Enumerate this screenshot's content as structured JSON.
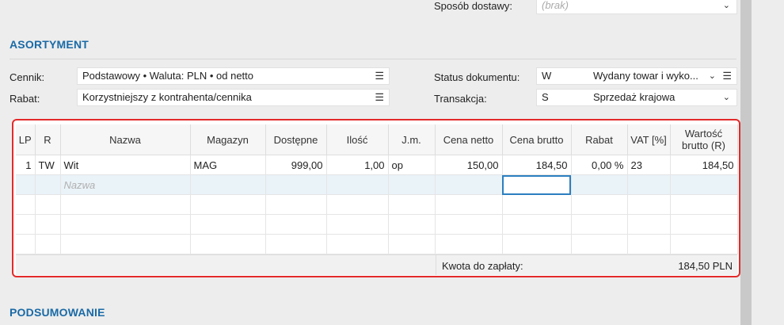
{
  "header": {
    "sposob_label": "Sposób dostawy:",
    "sposob_value": "(brak)"
  },
  "asortyment": {
    "title": "ASORTYMENT",
    "cennik_label": "Cennik:",
    "cennik_value": "Podstawowy • Waluta: PLN • od netto",
    "rabat_label": "Rabat:",
    "rabat_value": "Korzystniejszy z kontrahenta/cennika",
    "status_label": "Status dokumentu:",
    "status_code": "W",
    "status_value": "Wydany towar i wyko...",
    "transakcja_label": "Transakcja:",
    "transakcja_code": "S",
    "transakcja_value": "Sprzedaż krajowa"
  },
  "grid": {
    "columns": [
      "LP",
      "R",
      "Nazwa",
      "Magazyn",
      "Dostępne",
      "Ilość",
      "J.m.",
      "Cena netto",
      "Cena brutto",
      "Rabat",
      "VAT [%]",
      "Wartość brutto (R)"
    ],
    "row1": {
      "lp": "1",
      "r": "TW",
      "nazwa": "Wit",
      "magazyn": "MAG",
      "dostepne": "999,00",
      "ilosc": "1,00",
      "jm": "op",
      "cena_netto": "150,00",
      "cena_brutto": "184,50",
      "rabat": "0,00 %",
      "vat": "23",
      "wartosc": "184,50"
    },
    "new_row_placeholder": "Nazwa",
    "footer_label": "Kwota do zapłaty:",
    "footer_value": "184,50 PLN"
  },
  "podsumowanie": {
    "title": "PODSUMOWANIE"
  },
  "icons": {
    "menu": "☰",
    "chevron": "⌄"
  }
}
